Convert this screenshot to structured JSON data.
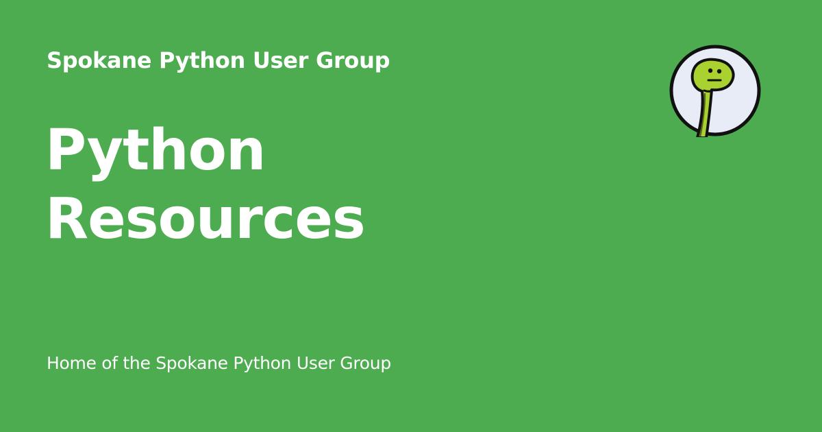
{
  "site": {
    "name": "Spokane Python User Group"
  },
  "page": {
    "title_line_1": "Python",
    "title_line_2": "Resources",
    "description": "Home of the Spokane Python User Group"
  },
  "logo": {
    "icon": "snake-mascot-icon"
  },
  "colors": {
    "background": "#4dac50",
    "text": "#ffffff",
    "logo_background": "#e8ecf7",
    "logo_outline": "#111111",
    "snake": "#a9d12f"
  }
}
